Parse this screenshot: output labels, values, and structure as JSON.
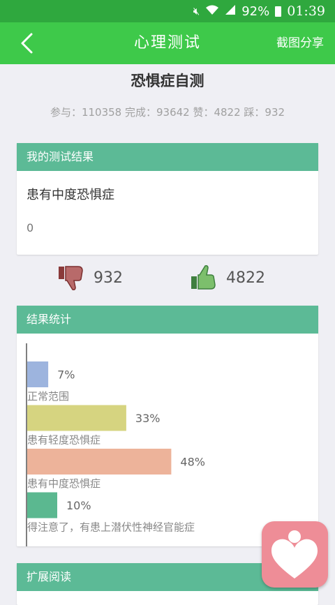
{
  "status_bar": {
    "battery": "92%",
    "time": "01:39"
  },
  "app_bar": {
    "title": "心理测试",
    "share_label": "截图分享"
  },
  "test": {
    "title": "恐惧症自测",
    "stats_line": "参与：110358 完成：93642 赞：4822 踩：932"
  },
  "result_card": {
    "header": "我的测试结果",
    "result": "患有中度恐惧症",
    "score": "0"
  },
  "votes": {
    "dislikes": "932",
    "likes": "4822"
  },
  "stats_card": {
    "header": "结果统计"
  },
  "read_card": {
    "header": "扩展阅读"
  },
  "colors": {
    "status_bar": "#2fa83e",
    "app_bar": "#3ec94a",
    "card_header": "#5cba96",
    "fab": "#ee8d97"
  },
  "icons": [
    "mute-icon",
    "wifi-icon",
    "signal-icon",
    "battery-icon",
    "back-chevron-icon",
    "thumbs-down-icon",
    "thumbs-up-icon",
    "heart-person-icon"
  ],
  "chart_data": {
    "type": "bar",
    "orientation": "horizontal",
    "categories": [
      "正常范围",
      "患有轻度恐惧症",
      "患有中度恐惧症",
      "得注意了，有患上潜伏性神经官能症"
    ],
    "values": [
      7,
      33,
      48,
      10
    ],
    "labels": [
      "7%",
      "33%",
      "48%",
      "10%"
    ],
    "colors": [
      "#9db4de",
      "#d6d480",
      "#edb39a",
      "#5bb890"
    ],
    "xlim": [
      0,
      100
    ]
  }
}
